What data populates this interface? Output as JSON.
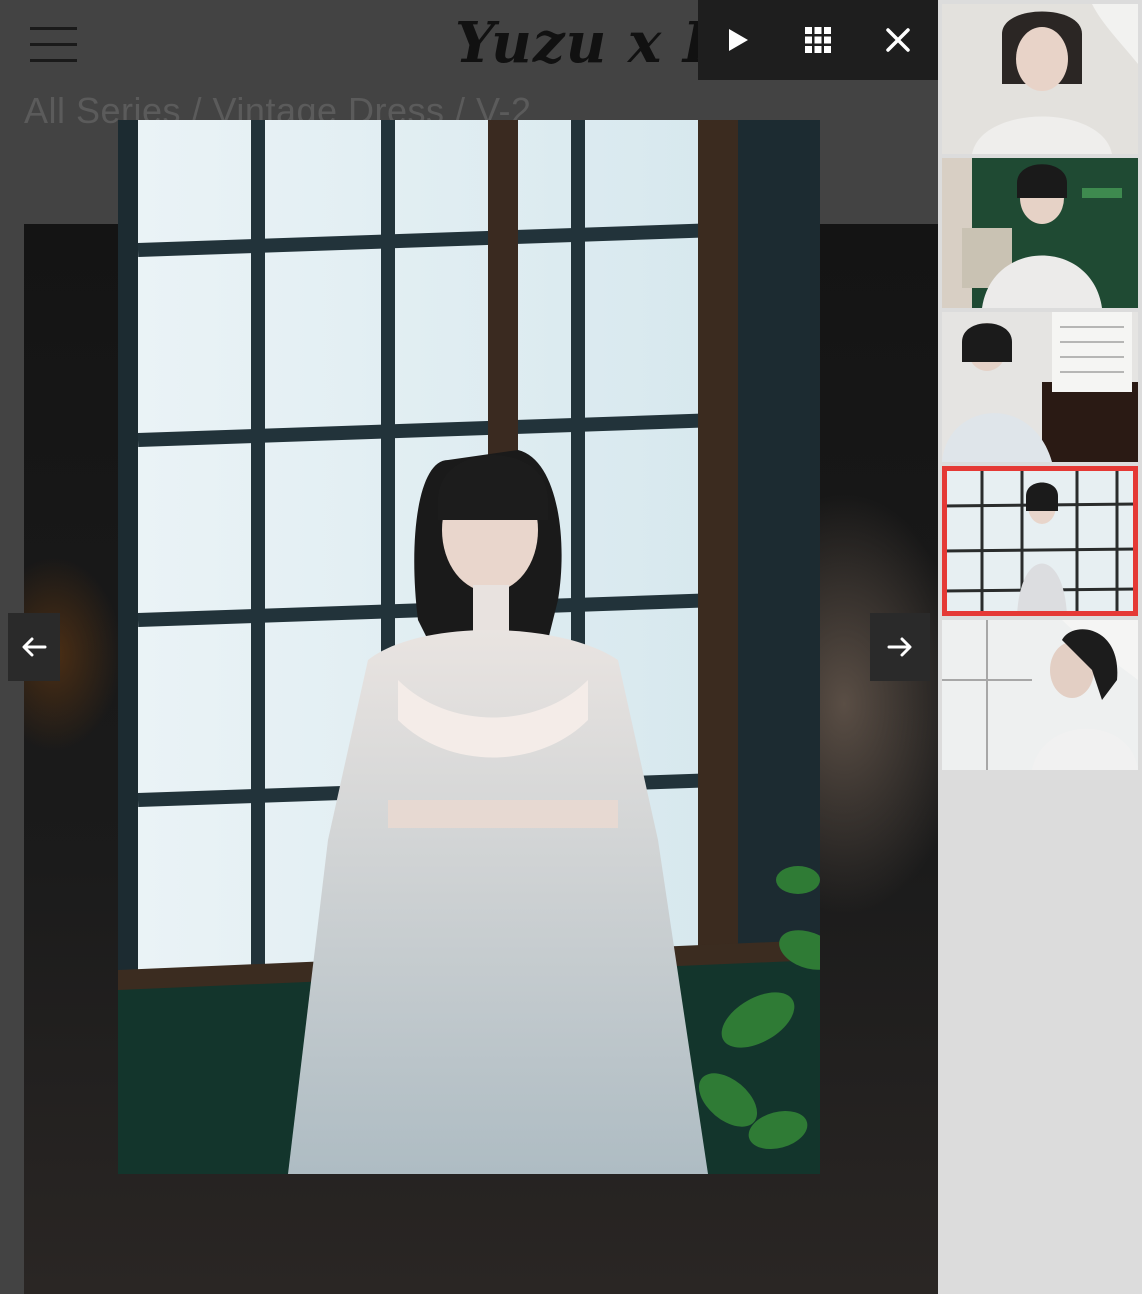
{
  "header": {
    "logo_text": "Yuzu x Pic"
  },
  "breadcrumb": {
    "text": "All Series / Vintage Dress / V-2"
  },
  "lightbox": {
    "toolbar": [
      {
        "name": "play-button",
        "icon": "play-icon"
      },
      {
        "name": "grid-button",
        "icon": "grid-icon"
      },
      {
        "name": "close-button",
        "icon": "close-icon"
      }
    ],
    "prev_icon": "arrow-left-icon",
    "next_icon": "arrow-right-icon",
    "active_index": 3
  },
  "thumbnails": [
    {
      "name": "thumb-portrait-lace"
    },
    {
      "name": "thumb-green-room"
    },
    {
      "name": "thumb-piano"
    },
    {
      "name": "thumb-window"
    },
    {
      "name": "thumb-profile"
    }
  ],
  "colors": {
    "accent_active": "#e53935",
    "toolbar_bg": "#1e1e1e",
    "strip_bg": "#dcdcdc"
  }
}
